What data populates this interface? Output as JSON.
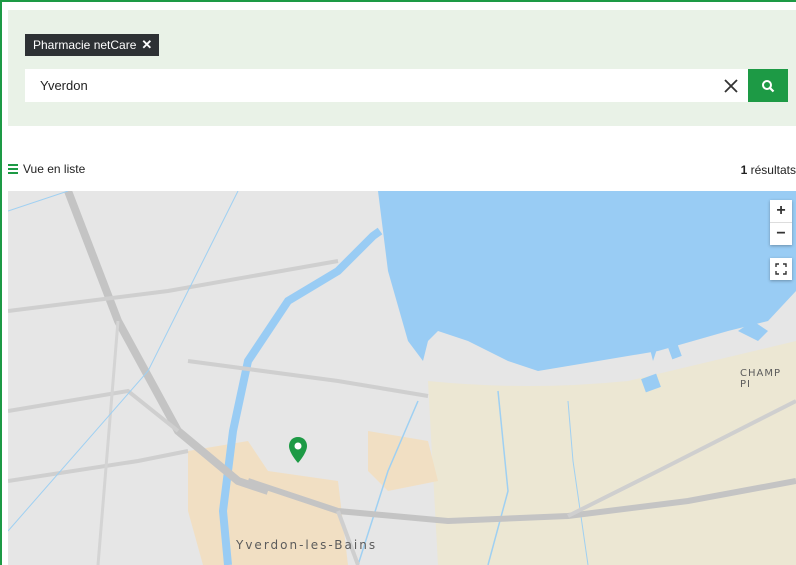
{
  "filter": {
    "tag_label": "Pharmacie netCare",
    "remove_symbol": "✕"
  },
  "search": {
    "value": "Yverdon",
    "placeholder": ""
  },
  "list": {
    "toggle_label": "Vue en liste",
    "results_count": "1",
    "results_label": "résultats"
  },
  "map": {
    "zoom_in": "+",
    "zoom_out": "−",
    "town_label": "Yverdon-les-Bains",
    "district_label": "CHAMP PI",
    "colors": {
      "water": "#99ccf4",
      "land": "#e6e6e6",
      "beach": "#ece7d3",
      "urban": "#f1dfc3",
      "road": "#c9c9c9",
      "accent": "#1d9a45"
    }
  }
}
